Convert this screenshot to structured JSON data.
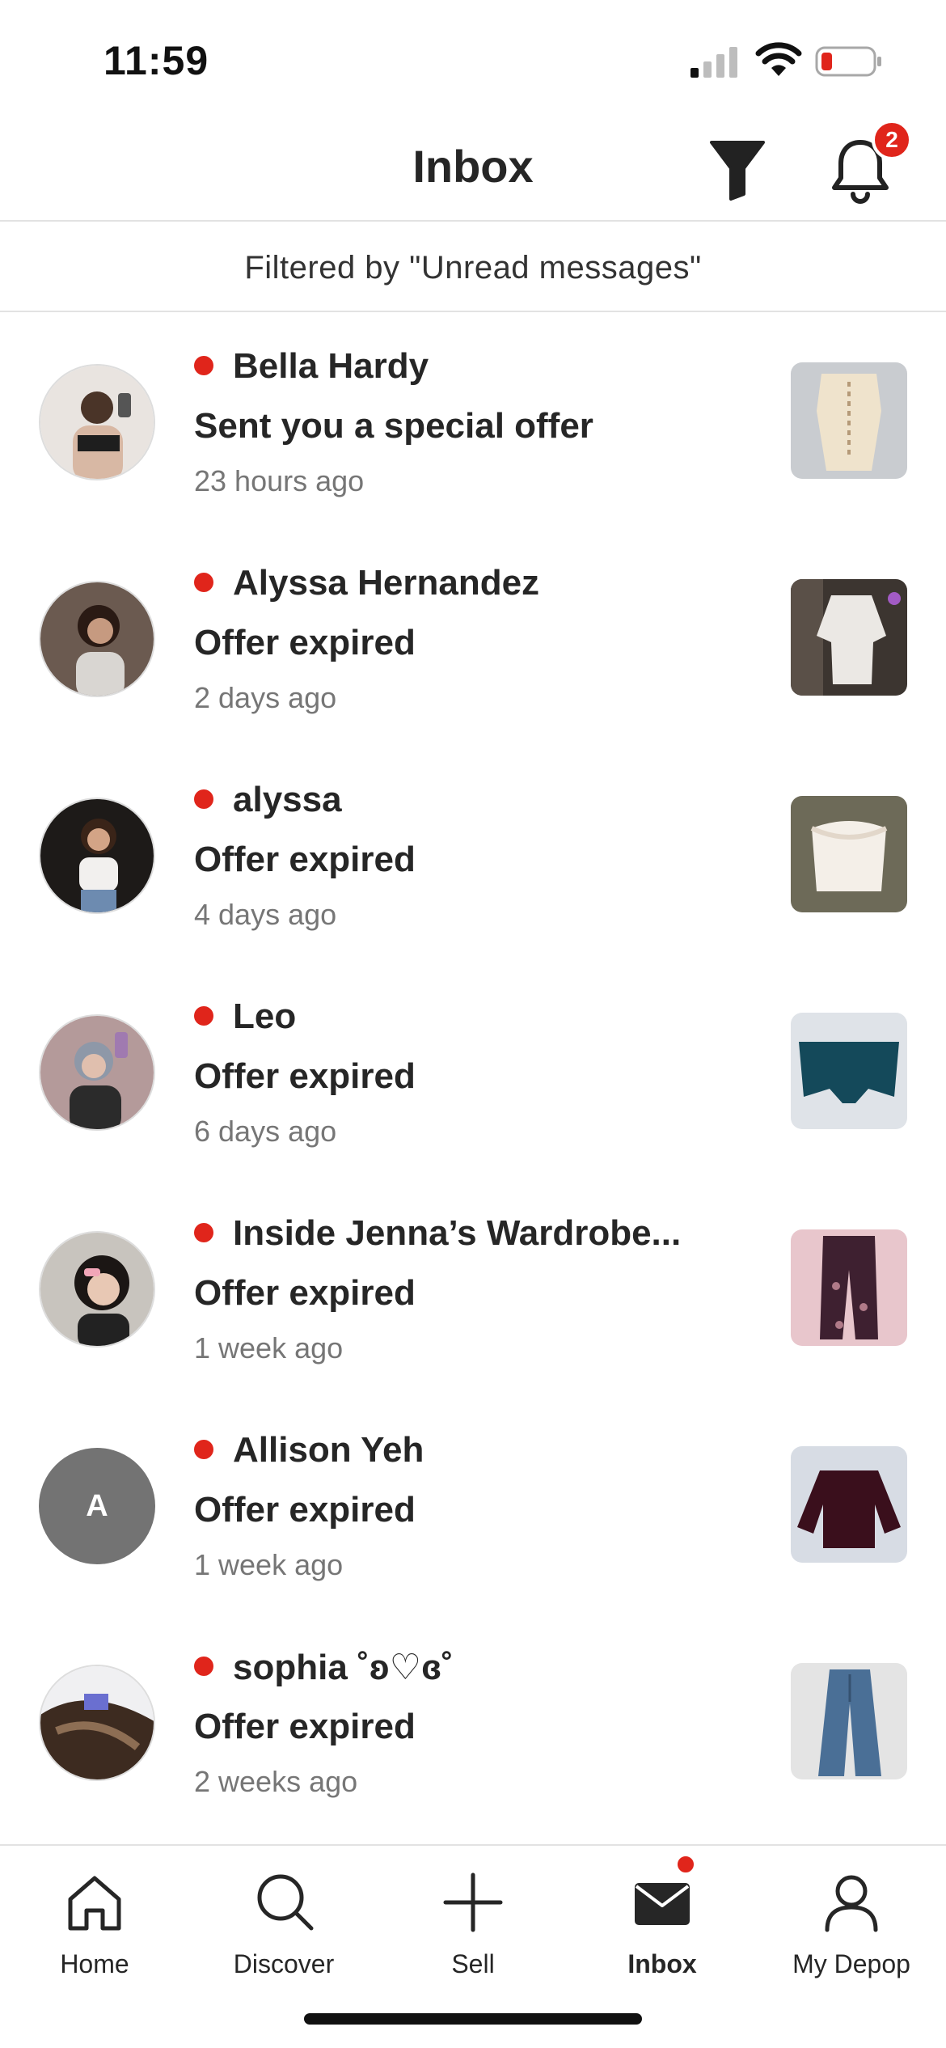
{
  "status_bar": {
    "time": "11:59"
  },
  "header": {
    "title": "Inbox",
    "notification_count": "2"
  },
  "filter_banner": {
    "text": "Filtered by \"Unread messages\""
  },
  "colors": {
    "accent_red": "#e0251b",
    "text_primary": "#262626",
    "text_secondary": "#767676",
    "divider": "#e2e2e2"
  },
  "messages": [
    {
      "name": "Bella Hardy",
      "message": "Sent you a special offer",
      "time": "23 hours ago"
    },
    {
      "name": "Alyssa Hernandez",
      "message": "Offer expired",
      "time": "2 days ago"
    },
    {
      "name": "alyssa",
      "message": "Offer expired",
      "time": "4 days ago"
    },
    {
      "name": "Leo",
      "message": "Offer expired",
      "time": "6 days ago"
    },
    {
      "name": "Inside Jenna’s Wardrobe...",
      "message": "Offer expired",
      "time": "1 week ago"
    },
    {
      "name": "Allison Yeh",
      "avatar_letter": "A",
      "message": "Offer expired",
      "time": "1 week ago"
    },
    {
      "name": "sophia ˚ʚ♡ɞ˚",
      "message": "Offer expired",
      "time": "2 weeks ago"
    }
  ],
  "tabbar": {
    "items": [
      {
        "label": "Home",
        "icon": "home-icon"
      },
      {
        "label": "Discover",
        "icon": "search-icon"
      },
      {
        "label": "Sell",
        "icon": "plus-icon"
      },
      {
        "label": "Inbox",
        "icon": "mail-icon",
        "active": true
      },
      {
        "label": "My Depop",
        "icon": "profile-icon"
      }
    ]
  }
}
